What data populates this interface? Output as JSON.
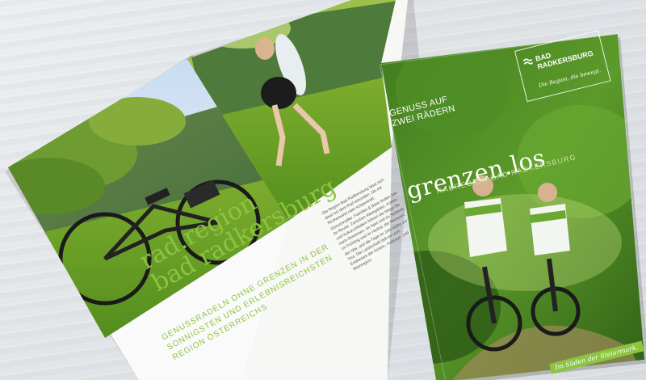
{
  "spread": {
    "headline_line1": "rad.region",
    "headline_line2": "bad radkersburg",
    "sub_line1": "GENUSSRADELN OHNE GRENZEN IN DER",
    "sub_line2": "SONNIGSTEN UND ERLEBNISREICHSTEN",
    "sub_line3": "REGION ÖSTERREICHS",
    "body_text": "Die Region Bad Radkersburg lässt sich ideal mit dem Rad erkunden. Ob mit Rückenwind oder Körperkraft, Genussradler, Familien & Biker finden hier ihr Revier. Zwischen Weingärten, Kürbis- und Kukuruzfeldern führen die Wege bis nach Slowenien. Im April und im Sommer, im Frühling und im Herbst, die Murauen, der Mai, und die Tage im Jahr laden zur Tour. Die Landschaft lädt ein zum Entdecken der Kürbis-, Kukuruz- und Weinregion."
  },
  "cover": {
    "logo_line1": "BAD",
    "logo_line2": "RADKERSBURG",
    "logo_tagline": "Die Region, die bewegt.",
    "genuss_line1": "GENUSS AUF",
    "genuss_line2": "ZWEI RÄDERN",
    "title": "grenzen.los",
    "subtitle": "RADREGION BAD RADKERSBURG",
    "footer_tag": "Im Süden der Steiermark."
  },
  "colors": {
    "accent_green": "#8cc43f",
    "cover_green": "#3f7a1e",
    "background": "#e4e7ea"
  }
}
